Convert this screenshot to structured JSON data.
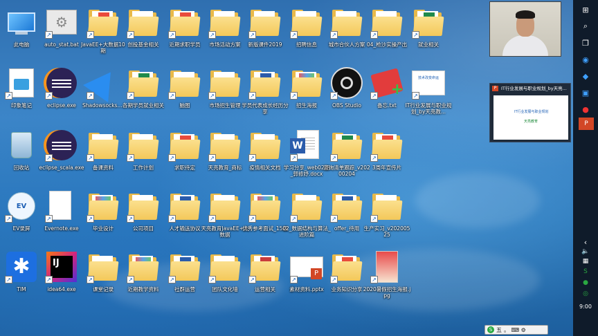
{
  "desktop": {
    "icons": [
      {
        "label": "此电脑",
        "kind": "pc"
      },
      {
        "label": "auto_stat.bat",
        "kind": "bat"
      },
      {
        "label": "JavaEE+大数据10期",
        "kind": "folder-pdf"
      },
      {
        "label": "创投基金相关",
        "kind": "folder"
      },
      {
        "label": "近期求职学员",
        "kind": "folder-pdf"
      },
      {
        "label": "市场活动方案",
        "kind": "folder"
      },
      {
        "label": "新版课件2019",
        "kind": "folder"
      },
      {
        "label": "招聘信息",
        "kind": "folder-plus"
      },
      {
        "label": "城市合伙人方案",
        "kind": "folder"
      },
      {
        "label": "04_枪沙实操产出",
        "kind": "folder"
      },
      {
        "label": "就业相关",
        "kind": "folder-xls"
      },
      {
        "label": "印象笔记",
        "kind": "evernote-note"
      },
      {
        "label": "eclipse.exe",
        "kind": "eclipse"
      },
      {
        "label": "Shadowsocks....",
        "kind": "shadowsocks"
      },
      {
        "label": "各期学员就业相关",
        "kind": "folder-xls"
      },
      {
        "label": "脑图",
        "kind": "folder"
      },
      {
        "label": "市场招生管理",
        "kind": "folder"
      },
      {
        "label": "学员代表成长经历分享",
        "kind": "folder-doc"
      },
      {
        "label": "招生海报",
        "kind": "folder-color"
      },
      {
        "label": "OBS Studio",
        "kind": "obs"
      },
      {
        "label": "备忘.txt",
        "kind": "memo"
      },
      {
        "label": "IT行业发展与职业规划_by天亮教...",
        "kind": "ppt-thumb"
      },
      {
        "label": "回收站",
        "kind": "recycle"
      },
      {
        "label": "eclipse_scala.exe",
        "kind": "eclipse"
      },
      {
        "label": "备课资料",
        "kind": "folder"
      },
      {
        "label": "工作计划",
        "kind": "folder"
      },
      {
        "label": "求职待定",
        "kind": "folder-pdf"
      },
      {
        "label": "天亮教育_商标",
        "kind": "folder"
      },
      {
        "label": "疫情相关文档",
        "kind": "folder"
      },
      {
        "label": "学习分享_web02期_郭修妤.docx",
        "kind": "word"
      },
      {
        "label": "咨询清单跟踪_v20200204",
        "kind": "folder-xls"
      },
      {
        "label": "3周年宣传片",
        "kind": "folder-pdf"
      },
      {
        "label": "EV录屏",
        "kind": "ev"
      },
      {
        "label": "Evernote.exe",
        "kind": "blank"
      },
      {
        "label": "毕业设计",
        "kind": "folder-color"
      },
      {
        "label": "公司项目",
        "kind": "folder"
      },
      {
        "label": "人才输送协议",
        "kind": "folder-doc"
      },
      {
        "label": "天亮教育JavaEE+大数据",
        "kind": "folder"
      },
      {
        "label": "优秀参考面试_15级",
        "kind": "folder-color"
      },
      {
        "label": "02_数据结构与算法_进阶篇",
        "kind": "folder"
      },
      {
        "label": "offer_待用",
        "kind": "folder-doc"
      },
      {
        "label": "生产实习_v20200525",
        "kind": "folder-plus"
      },
      {
        "label": "TIM",
        "kind": "tim"
      },
      {
        "label": "idea64.exe",
        "kind": "idea"
      },
      {
        "label": "课堂记录",
        "kind": "folder"
      },
      {
        "label": "近期教学资料",
        "kind": "folder-color"
      },
      {
        "label": "社群运营",
        "kind": "folder-doc"
      },
      {
        "label": "团队文化墙",
        "kind": "folder"
      },
      {
        "label": "运营相关",
        "kind": "folder-xls-red"
      },
      {
        "label": "素材资料.pptx",
        "kind": "pptx"
      },
      {
        "label": "业务知识分享",
        "kind": "folder-pdf"
      },
      {
        "label": "2020暑假招生海报.jpg",
        "kind": "poster"
      }
    ]
  },
  "video": {
    "label": "webcam"
  },
  "preview": {
    "title": "IT行业发展与职业规划_by天亮...",
    "slide_title": "IT行业发展与职业规划",
    "slide_brand": "天亮教育"
  },
  "taskbar": {
    "time": "9:00",
    "icons": [
      "windows-icon",
      "search-icon",
      "taskview-icon",
      "edge-icon",
      "feishu-icon",
      "share-icon",
      "pin-icon",
      "powerpoint-icon"
    ],
    "tray": [
      "chevron-up-icon",
      "volume-icon",
      "network-icon",
      "sogou-icon",
      "wechat-icon",
      "360-icon"
    ]
  },
  "ime": {
    "mode": "五",
    "extra": "。 ⌨ ⚙"
  },
  "colors": {
    "taskbar": "#0f1b2a",
    "folder": "#f3c85a",
    "accent": "#1d5fb4"
  }
}
